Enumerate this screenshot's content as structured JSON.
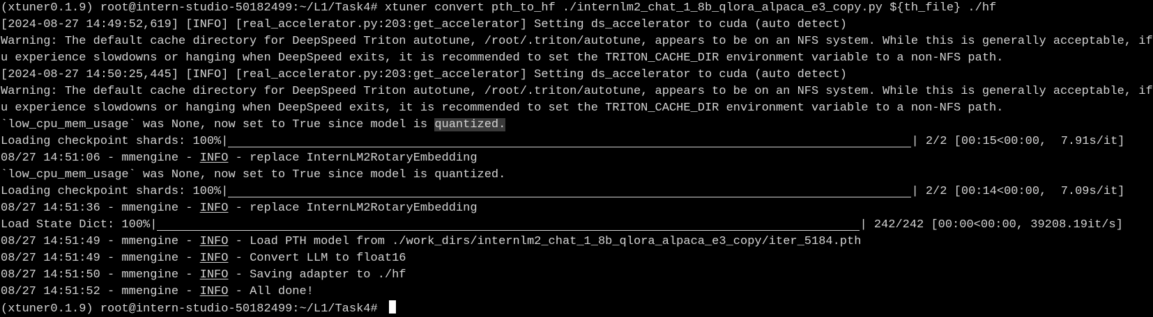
{
  "terminal": {
    "lines": [
      "(xtuner0.1.9) root@intern-studio-50182499:~/L1/Task4# xtuner convert pth_to_hf ./internlm2_chat_1_8b_qlora_alpaca_e3_copy.py ${th_file} ./hf",
      "[2024-08-27 14:49:52,619] [INFO] [real_accelerator.py:203:get_accelerator] Setting ds_accelerator to cuda (auto detect)",
      "Warning: The default cache directory for DeepSpeed Triton autotune, /root/.triton/autotune, appears to be on an NFS system. While this is generally acceptable, if yo",
      "u experience slowdowns or hanging when DeepSpeed exits, it is recommended to set the TRITON_CACHE_DIR environment variable to a non-NFS path.",
      "[2024-08-27 14:50:25,445] [INFO] [real_accelerator.py:203:get_accelerator] Setting ds_accelerator to cuda (auto detect)",
      "Warning: The default cache directory for DeepSpeed Triton autotune, /root/.triton/autotune, appears to be on an NFS system. While this is generally acceptable, if yo",
      "u experience slowdowns or hanging when DeepSpeed exits, it is recommended to set the TRITON_CACHE_DIR environment variable to a non-NFS path."
    ],
    "quantized_line_prefix": "`low_cpu_mem_usage` was None, now set to True since model is ",
    "quantized_word": "quantized.",
    "shards1": {
      "label": "Loading checkpoint shards: 100%|",
      "stats": "| 2/2 [00:15<00:00,  7.91s/it]"
    },
    "log1": {
      "prefix": "08/27 14:51:06 - mmengine - ",
      "level": "INFO",
      "msg": " - replace InternLM2RotaryEmbedding"
    },
    "quantized_line2": "`low_cpu_mem_usage` was None, now set to True since model is quantized.",
    "shards2": {
      "label": "Loading checkpoint shards: 100%|",
      "stats": "| 2/2 [00:14<00:00,  7.09s/it]"
    },
    "log2": {
      "prefix": "08/27 14:51:36 - mmengine - ",
      "level": "INFO",
      "msg": " - replace InternLM2RotaryEmbedding"
    },
    "state_dict": {
      "label": "Load State Dict: 100%|",
      "stats": "| 242/242 [00:00<00:00, 39208.19it/s]"
    },
    "log3": {
      "prefix": "08/27 14:51:49 - mmengine - ",
      "level": "INFO",
      "msg": " - Load PTH model from ./work_dirs/internlm2_chat_1_8b_qlora_alpaca_e3_copy/iter_5184.pth"
    },
    "log4": {
      "prefix": "08/27 14:51:49 - mmengine - ",
      "level": "INFO",
      "msg": " - Convert LLM to float16"
    },
    "log5": {
      "prefix": "08/27 14:51:50 - mmengine - ",
      "level": "INFO",
      "msg": " - Saving adapter to ./hf"
    },
    "log6": {
      "prefix": "08/27 14:51:52 - mmengine - ",
      "level": "INFO",
      "msg": " - All done!"
    },
    "prompt": "(xtuner0.1.9) root@intern-studio-50182499:~/L1/Task4# "
  },
  "colors": {
    "background": "#000000",
    "foreground": "#d4d4d4",
    "selection": "#3a3a3a",
    "cursor": "#ffffff"
  }
}
